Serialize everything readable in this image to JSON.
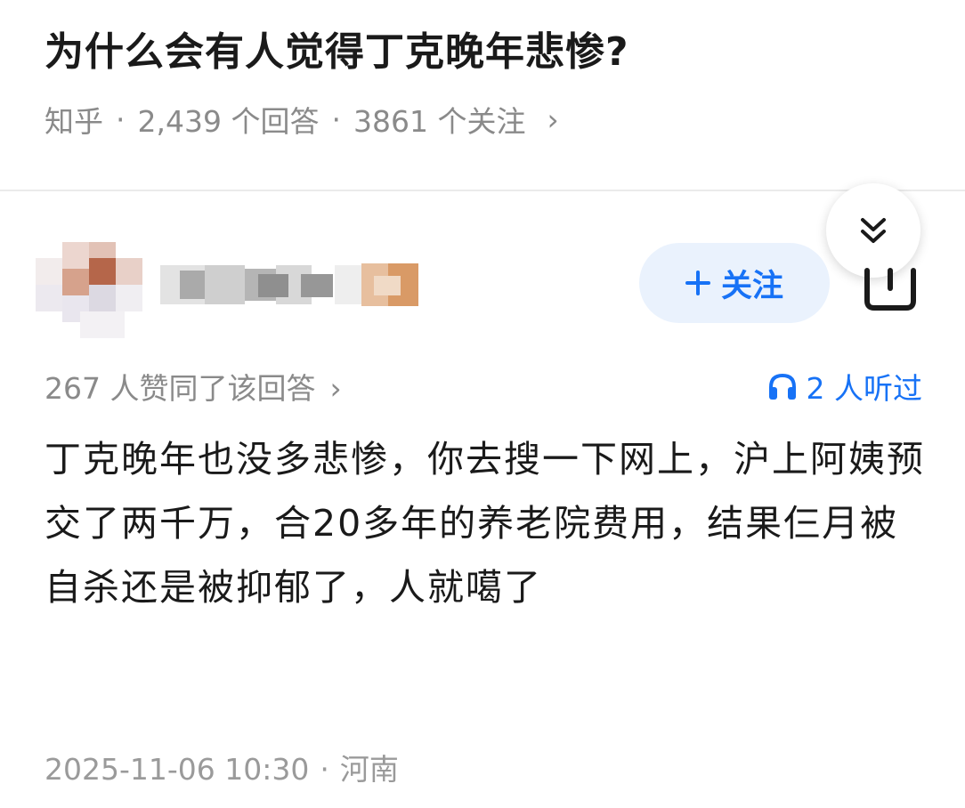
{
  "question": {
    "title": "为什么会有人觉得丁克晚年悲惨?",
    "source": "知乎",
    "answers": "2,439 个回答",
    "followers": "3861 个关注",
    "chevron": "›"
  },
  "answer": {
    "follow_label": "关注",
    "follow_icon": "plus-icon",
    "upvotes": "267 人赞同了该回答",
    "upvotes_chevron": "›",
    "listened": "2 人听过",
    "content": "丁克晚年也没多悲惨，你去搜一下网上，沪上阿姨预交了两千万，合20多年的养老院费用，结果仨月被自杀还是被抑郁了，人就噶了",
    "date": "2025-11-06 10:30",
    "location": "河南"
  },
  "colors": {
    "accent": "#1772f6",
    "muted": "#8a8a8a",
    "text": "#1a1a1a"
  }
}
